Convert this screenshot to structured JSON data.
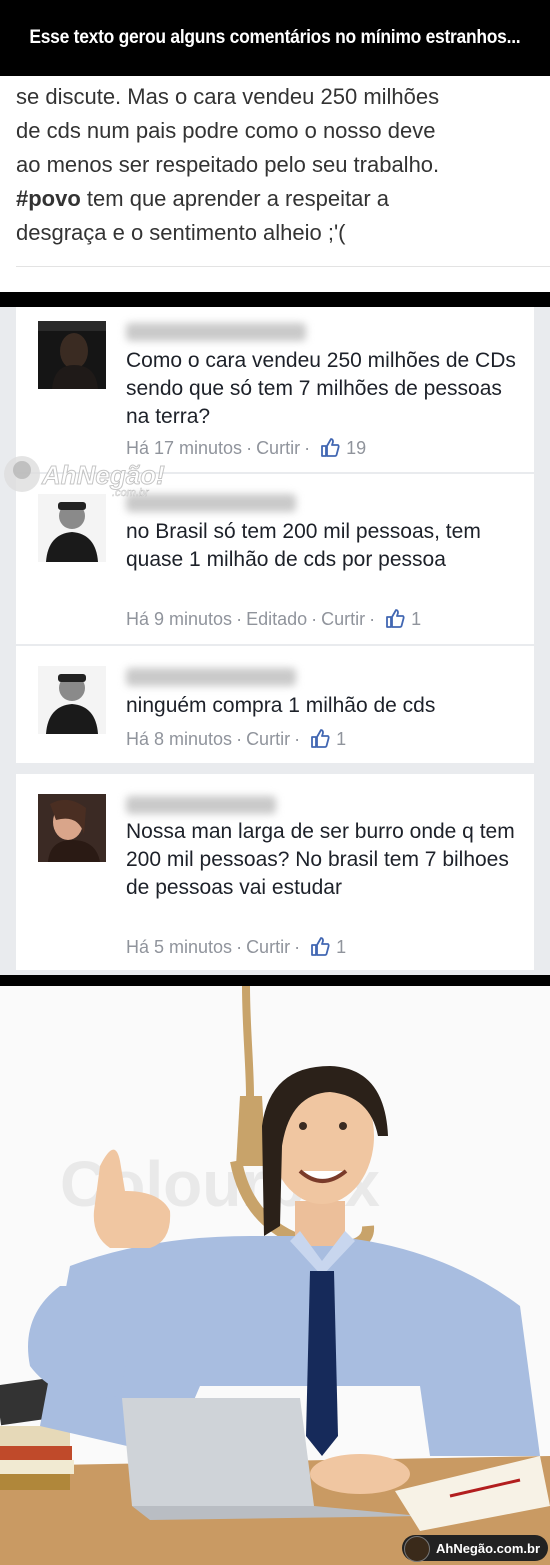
{
  "header": {
    "title": "Esse texto gerou alguns comentários no mínimo estranhos..."
  },
  "post": {
    "lines": [
      "se discute.  Mas o cara vendeu 250 milhões",
      "de cds num pais podre como o nosso  deve",
      "ao menos ser respeitado pelo seu trabalho.",
      "tem que aprender a respeitar a",
      "desgraça e o sentimento alheio ;'("
    ],
    "hashtag": "#povo"
  },
  "comments": [
    {
      "text": "Como o cara vendeu 250 milhões de CDs sendo que só tem 7 milhões de pessoas na terra?",
      "time": "Há 17 minutos",
      "edited": "",
      "like_label": "Curtir",
      "likes": "19"
    },
    {
      "text": "no Brasil só tem 200 mil pessoas, tem quase 1 milhão de cds por pessoa",
      "time": "Há 9 minutos",
      "edited": "Editado",
      "like_label": "Curtir",
      "likes": "1"
    },
    {
      "text": "ninguém compra 1 milhão de cds",
      "time": "Há 8 minutos",
      "edited": "",
      "like_label": "Curtir",
      "likes": "1"
    },
    {
      "text": "Nossa man larga de ser burro onde q tem 200 mil pessoas? No brasil tem 7 bilhoes de pessoas vai estudar",
      "time": "Há 5 minutos",
      "edited": "",
      "like_label": "Curtir",
      "likes": "1"
    }
  ],
  "separator": "·",
  "watermark": {
    "text": "AhNegão!",
    "sub": ".com.br"
  },
  "photo": {
    "stock_watermark": "Colourbox"
  },
  "badge": {
    "text": "AhNegão.com.br"
  },
  "colors": {
    "meta_gray": "#90949c",
    "like_blue": "#4267b2",
    "comment_bg": "#e9ebee"
  }
}
